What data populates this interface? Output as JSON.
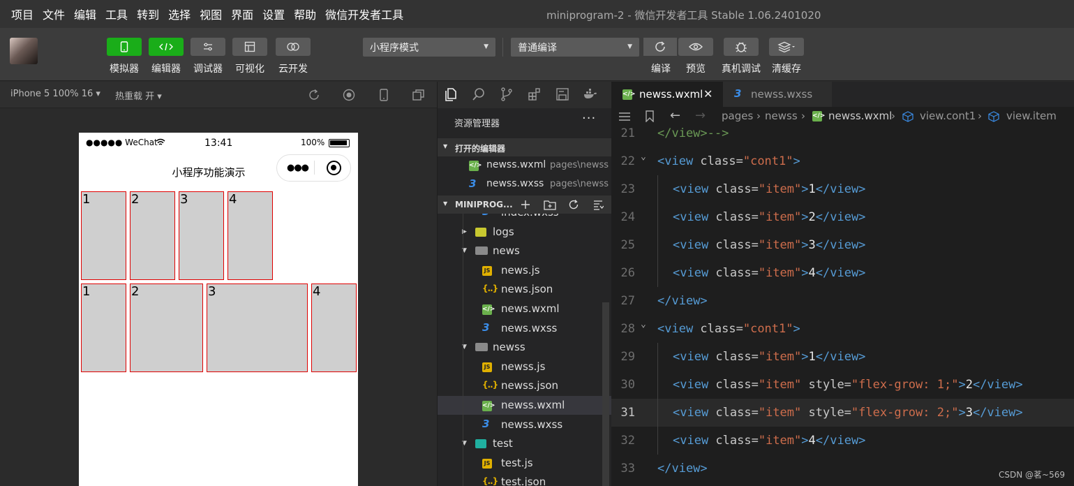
{
  "menu": [
    "项目",
    "文件",
    "编辑",
    "工具",
    "转到",
    "选择",
    "视图",
    "界面",
    "设置",
    "帮助",
    "微信开发者工具"
  ],
  "window_title": "miniprogram-2 - 微信开发者工具 Stable 1.06.2401020",
  "toolbar": {
    "buttons": [
      {
        "label": "模拟器",
        "icon": "phone-icon"
      },
      {
        "label": "编辑器",
        "icon": "code-icon"
      },
      {
        "label": "调试器",
        "icon": "sliders-icon"
      },
      {
        "label": "可视化",
        "icon": "layout-icon"
      },
      {
        "label": "云开发",
        "icon": "cloud-icon"
      }
    ],
    "mode_select": "小程序模式",
    "compile_select": "普通编译",
    "right_buttons": [
      {
        "label": "编译",
        "icon": "refresh-icon"
      },
      {
        "label": "预览",
        "icon": "eye-icon"
      },
      {
        "label": "真机调试",
        "icon": "bug-icon"
      },
      {
        "label": "清缓存",
        "icon": "layers-icon"
      }
    ]
  },
  "simulator": {
    "device": "iPhone 5 100% 16 ▾",
    "hot_reload": "热重载 开 ▾",
    "status": {
      "carrier": "●●●●● WeChat",
      "time": "13:41",
      "battery": "100%"
    },
    "nav_title": "小程序功能演示",
    "row1": [
      "1",
      "2",
      "3",
      "4"
    ],
    "row2": [
      "1",
      "2",
      "3",
      "4"
    ],
    "row2_flex_grow": [
      0,
      1,
      2,
      0
    ]
  },
  "explorer": {
    "title": "资源管理器",
    "more": "···",
    "open_editors_label": "打开的编辑器",
    "open_editors": [
      {
        "name": "newss.wxml",
        "path": "pages\\newss",
        "type": "wxml"
      },
      {
        "name": "newss.wxss",
        "path": "pages\\newss",
        "type": "wxss"
      }
    ],
    "project_label": "MINIPROG...",
    "tree": [
      {
        "name": "index.wxss",
        "type": "wxss",
        "depth": 2
      },
      {
        "name": "logs",
        "type": "folder-logs",
        "depth": 1,
        "collapsed": true
      },
      {
        "name": "news",
        "type": "folder",
        "depth": 1
      },
      {
        "name": "news.js",
        "type": "js",
        "depth": 2
      },
      {
        "name": "news.json",
        "type": "json",
        "depth": 2
      },
      {
        "name": "news.wxml",
        "type": "wxml",
        "depth": 2
      },
      {
        "name": "news.wxss",
        "type": "wxss",
        "depth": 2
      },
      {
        "name": "newss",
        "type": "folder",
        "depth": 1
      },
      {
        "name": "newss.js",
        "type": "js",
        "depth": 2
      },
      {
        "name": "newss.json",
        "type": "json",
        "depth": 2
      },
      {
        "name": "newss.wxml",
        "type": "wxml",
        "depth": 2,
        "selected": true
      },
      {
        "name": "newss.wxss",
        "type": "wxss",
        "depth": 2
      },
      {
        "name": "test",
        "type": "folder-test",
        "depth": 1
      },
      {
        "name": "test.js",
        "type": "js",
        "depth": 2
      },
      {
        "name": "test.json",
        "type": "json",
        "depth": 2
      }
    ]
  },
  "editor": {
    "tabs": [
      {
        "name": "newss.wxml",
        "type": "wxml",
        "active": true,
        "close": "✕"
      },
      {
        "name": "newss.wxss",
        "type": "wxss",
        "active": false
      }
    ],
    "breadcrumb": [
      "pages",
      "newss",
      "newss.wxml",
      "view.cont1",
      "view.item"
    ],
    "lines": [
      {
        "n": "21",
        "indent": 0,
        "tokens": [
          [
            "cmt",
            "</view>-->"
          ]
        ]
      },
      {
        "n": "22",
        "indent": 0,
        "fold": true,
        "tokens": [
          [
            "tag",
            "<view "
          ],
          [
            "attr",
            "class="
          ],
          [
            "str",
            "\"cont1\""
          ],
          [
            "tag",
            ">"
          ]
        ]
      },
      {
        "n": "23",
        "indent": 1,
        "tokens": [
          [
            "tag",
            "<view "
          ],
          [
            "attr",
            "class="
          ],
          [
            "str",
            "\"item\""
          ],
          [
            "tag",
            ">"
          ],
          [
            "txt",
            "1"
          ],
          [
            "tag",
            "</view>"
          ]
        ]
      },
      {
        "n": "24",
        "indent": 1,
        "tokens": [
          [
            "tag",
            "<view "
          ],
          [
            "attr",
            "class="
          ],
          [
            "str",
            "\"item\""
          ],
          [
            "tag",
            ">"
          ],
          [
            "txt",
            "2"
          ],
          [
            "tag",
            "</view>"
          ]
        ]
      },
      {
        "n": "25",
        "indent": 1,
        "tokens": [
          [
            "tag",
            "<view "
          ],
          [
            "attr",
            "class="
          ],
          [
            "str",
            "\"item\""
          ],
          [
            "tag",
            ">"
          ],
          [
            "txt",
            "3"
          ],
          [
            "tag",
            "</view>"
          ]
        ]
      },
      {
        "n": "26",
        "indent": 1,
        "tokens": [
          [
            "tag",
            "<view "
          ],
          [
            "attr",
            "class="
          ],
          [
            "str",
            "\"item\""
          ],
          [
            "tag",
            ">"
          ],
          [
            "txt",
            "4"
          ],
          [
            "tag",
            "</view>"
          ]
        ]
      },
      {
        "n": "27",
        "indent": 0,
        "tokens": [
          [
            "tag",
            "</view>"
          ]
        ]
      },
      {
        "n": "28",
        "indent": 0,
        "fold": true,
        "tokens": [
          [
            "tag",
            "<view "
          ],
          [
            "attr",
            "class="
          ],
          [
            "str",
            "\"cont1\""
          ],
          [
            "tag",
            ">"
          ]
        ]
      },
      {
        "n": "29",
        "indent": 1,
        "tokens": [
          [
            "tag",
            "<view "
          ],
          [
            "attr",
            "class="
          ],
          [
            "str",
            "\"item\""
          ],
          [
            "tag",
            ">"
          ],
          [
            "txt",
            "1"
          ],
          [
            "tag",
            "</view>"
          ]
        ]
      },
      {
        "n": "30",
        "indent": 1,
        "tokens": [
          [
            "tag",
            "<view "
          ],
          [
            "attr",
            "class="
          ],
          [
            "str",
            "\"item\""
          ],
          [
            "attr",
            " style="
          ],
          [
            "str",
            "\"flex-grow: 1;\""
          ],
          [
            "tag",
            ">"
          ],
          [
            "txt",
            "2"
          ],
          [
            "tag",
            "</view>"
          ]
        ]
      },
      {
        "n": "31",
        "indent": 1,
        "current": true,
        "tokens": [
          [
            "tag",
            "<view "
          ],
          [
            "attr",
            "class="
          ],
          [
            "str",
            "\"item\""
          ],
          [
            "attr",
            " style="
          ],
          [
            "str",
            "\"flex-grow: 2;\""
          ],
          [
            "tag",
            ">"
          ],
          [
            "txt",
            "3"
          ],
          [
            "tag",
            "</view>"
          ]
        ]
      },
      {
        "n": "32",
        "indent": 1,
        "tokens": [
          [
            "tag",
            "<view "
          ],
          [
            "attr",
            "class="
          ],
          [
            "str",
            "\"item\""
          ],
          [
            "tag",
            ">"
          ],
          [
            "txt",
            "4"
          ],
          [
            "tag",
            "</view>"
          ]
        ]
      },
      {
        "n": "33",
        "indent": 0,
        "tokens": [
          [
            "tag",
            "</view>"
          ]
        ]
      }
    ]
  },
  "watermark": "CSDN @茗~569",
  "colors": {
    "accent_green": "#1aad19",
    "item_fill": "#cfcfcf",
    "item_border": "#e00000",
    "tag": "#569cd6",
    "string": "#ce6d4c"
  }
}
